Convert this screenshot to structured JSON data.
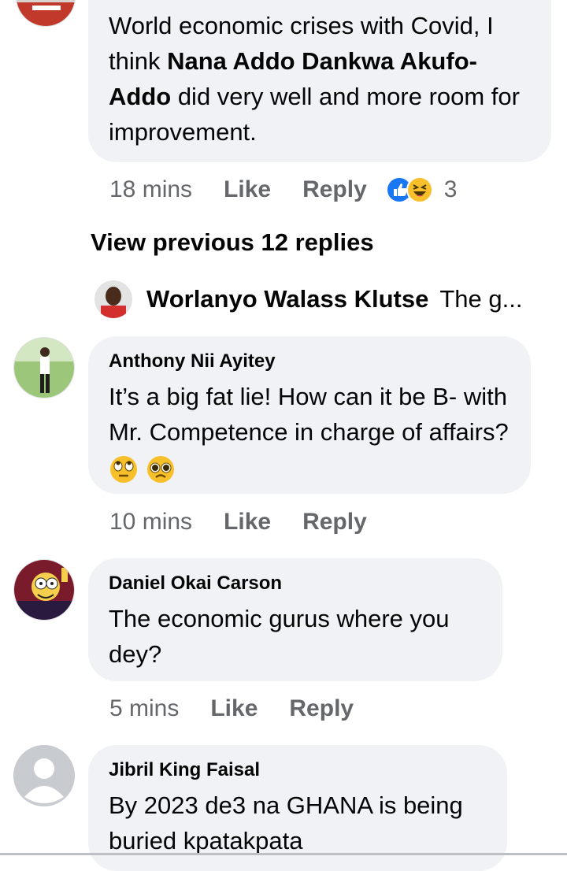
{
  "comment_top": {
    "text_part1": "World economic crises with Covid, I think ",
    "text_bold": "Nana Addo Dankwa Akufo-Addo",
    "text_part2": " did very well and more room for improvement.",
    "time": "18 mins",
    "like": "Like",
    "reply": "Reply",
    "reaction_count": "3"
  },
  "view_previous": "View previous 12 replies",
  "preview_reply": {
    "author": "Worlanyo Walass Klutse",
    "snippet": "The g..."
  },
  "comments": [
    {
      "author": "Anthony Nii Ayitey",
      "text": "It’s a big fat lie! How can it be B- with Mr. Competence in charge of affairs?",
      "time": "10 mins",
      "like": "Like",
      "reply": "Reply"
    },
    {
      "author": "Daniel Okai Carson",
      "text": "The economic gurus where you dey?",
      "time": "5 mins",
      "like": "Like",
      "reply": "Reply"
    },
    {
      "author": "Jibril King Faisal",
      "text": "By 2023 de3 na GHANA is being buried kpatakpata"
    }
  ],
  "icons": {
    "like": "like-reaction-icon",
    "haha": "haha-reaction-icon",
    "eyeroll": "eye-roll-emoji-icon",
    "pleading": "pleading-face-emoji-icon",
    "default_avatar": "default-avatar-icon"
  },
  "colors": {
    "bubble": "#f0f2f5",
    "meta_text": "#65676b",
    "like_blue": "#1877f2",
    "emoji_yellow": "#f7c02b"
  }
}
